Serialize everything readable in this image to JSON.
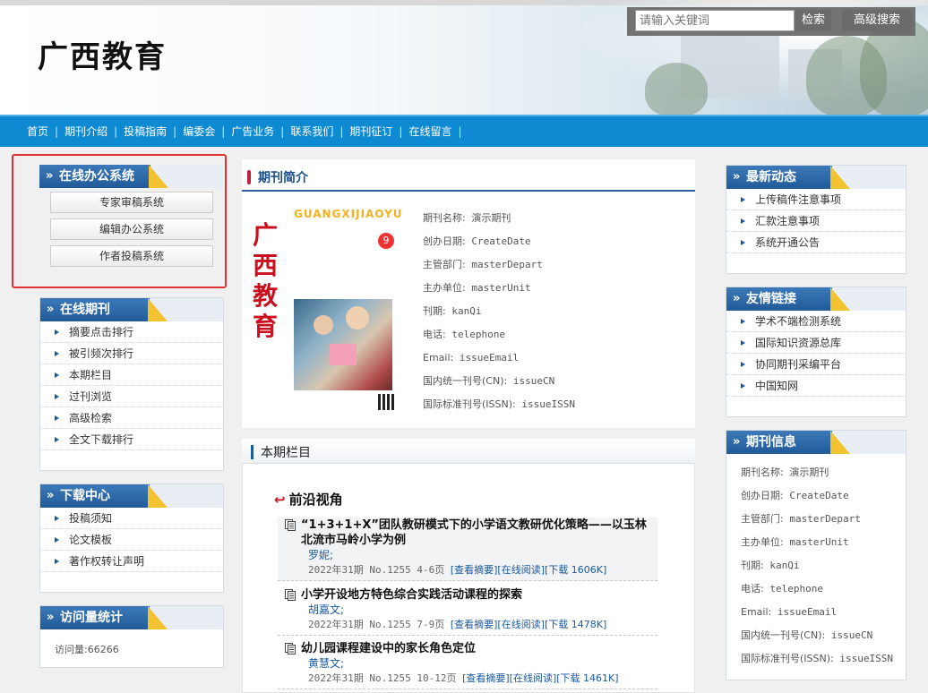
{
  "header": {
    "logo": "广西教育",
    "search_placeholder": "请输入关键词",
    "search_button": "检索",
    "advanced_search": "高级搜索"
  },
  "nav": {
    "items": [
      "首页",
      "期刊介绍",
      "投稿指南",
      "编委会",
      "广告业务",
      "联系我们",
      "期刊征订",
      "在线留言"
    ],
    "separator": "|"
  },
  "office": {
    "title": "在线办公系统",
    "buttons": [
      "专家审稿系统",
      "编辑办公系统",
      "作者投稿系统"
    ]
  },
  "online": {
    "title": "在线期刊",
    "items": [
      "摘要点击排行",
      "被引频次排行",
      "本期栏目",
      "过刊浏览",
      "高级检索",
      "全文下载排行"
    ]
  },
  "download": {
    "title": "下载中心",
    "items": [
      "投稿须知",
      "论文模板",
      "著作权转让声明"
    ]
  },
  "visits": {
    "title": "访问量统计",
    "text": "访问量:66266"
  },
  "intro": {
    "title": "期刊简介",
    "cover_pinyin": "GUANGXIJIAOYU",
    "cover_title": "广西教育",
    "cover_number": "9",
    "fields": [
      {
        "label": "期刊名称:",
        "value": "演示期刊"
      },
      {
        "label": "创办日期:",
        "value": "CreateDate"
      },
      {
        "label": "主管部门:",
        "value": "masterDepart"
      },
      {
        "label": "主办单位:",
        "value": "masterUnit"
      },
      {
        "label": "刊期:",
        "value": "kanQi"
      },
      {
        "label": "电话:",
        "value": "telephone"
      },
      {
        "label": "Email:",
        "value": "issueEmail"
      },
      {
        "label": "国内统一刊号(CN):",
        "value": "issueCN"
      },
      {
        "label": "国际标准刊号(ISSN):",
        "value": "issueISSN"
      }
    ]
  },
  "issue": {
    "title": "本期栏目",
    "section": "前沿视角",
    "articles": [
      {
        "title": "“1+3+1+X”团队教研模式下的小学语文教研优化策略——以玉林北流市马岭小学为例",
        "author": "罗妮;",
        "meta": "2022年31期 No.1255 4-6页",
        "links": "[查看摘要][在线阅读][下载 1606K]"
      },
      {
        "title": "小学开设地方特色综合实践活动课程的探索",
        "author": "胡嘉文;",
        "meta": "2022年31期 No.1255 7-9页",
        "links": "[查看摘要][在线阅读][下载 1478K]"
      },
      {
        "title": "幼儿园课程建设中的家长角色定位",
        "author": "黄慧文;",
        "meta": "2022年31期 No.1255 10-12页",
        "links": "[查看摘要][在线阅读][下载 1461K]"
      }
    ]
  },
  "news": {
    "title": "最新动态",
    "items": [
      "上传稿件注意事项",
      "汇款注意事项",
      "系统开通公告"
    ]
  },
  "links": {
    "title": "友情链接",
    "items": [
      "学术不端检测系统",
      "国际知识资源总库",
      "协同期刊采编平台",
      "中国知网"
    ]
  },
  "journal": {
    "title": "期刊信息",
    "fields": [
      {
        "label": "期刊名称:",
        "value": "演示期刊"
      },
      {
        "label": "创办日期:",
        "value": "CreateDate"
      },
      {
        "label": "主管部门:",
        "value": "masterDepart"
      },
      {
        "label": "主办单位:",
        "value": "masterUnit"
      },
      {
        "label": "刊期:",
        "value": "kanQi"
      },
      {
        "label": "电话:",
        "value": "telephone"
      },
      {
        "label": "Email:",
        "value": "issueEmail"
      },
      {
        "label": "国内统一刊号(CN):",
        "value": "issueCN"
      },
      {
        "label": "国际标准刊号(ISSN):",
        "value": "issueISSN"
      }
    ]
  },
  "colors": {
    "nav_bg": "#0e8ad2",
    "title_blue": "#225a98",
    "accent_yellow": "#f2c230",
    "highlight_red": "#e03030",
    "link_blue": "#1a5aa0"
  }
}
